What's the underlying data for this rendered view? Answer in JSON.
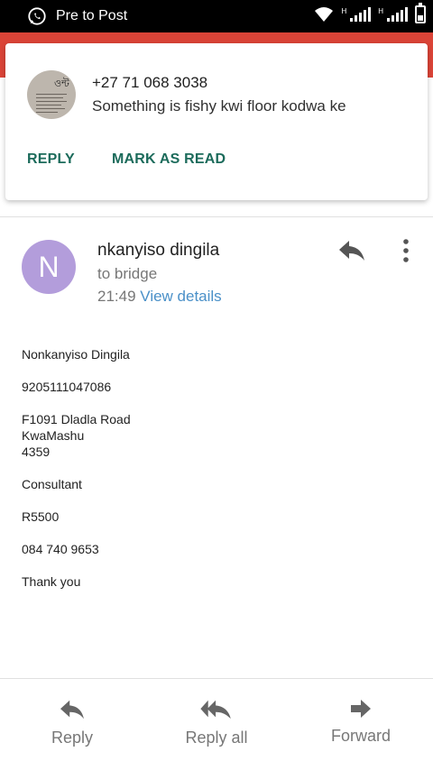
{
  "status_bar": {
    "app_title": "Pre to Post",
    "network_label_1": "H",
    "network_label_2": "H"
  },
  "notification": {
    "sender": "+27 71 068 3038",
    "message": "Something is fishy kwi floor kodwa ke",
    "reply_label": "REPLY",
    "mark_read_label": "MARK AS READ",
    "avatar_glyph": "ওন্ট"
  },
  "email": {
    "avatar_letter": "N",
    "avatar_color": "#b39ddb",
    "from_name": "nkanyiso dingila",
    "to_line": "to bridge",
    "time": "21:49",
    "view_details": "View details",
    "body": {
      "name": "Nonkanyiso Dingila",
      "id_number": "9205111047086",
      "address_line1": "F1091 Dladla Road",
      "address_line2": "KwaMashu",
      "address_line3": "4359",
      "occupation": "Consultant",
      "amount": "R5500",
      "phone": "084 740 9653",
      "closing": "Thank you"
    }
  },
  "actions": {
    "reply": "Reply",
    "reply_all": "Reply all",
    "forward": "Forward"
  },
  "colors": {
    "app_bar_red": "#db4437",
    "notification_action_teal": "#1c6b5b",
    "link_blue": "#4a90c8"
  }
}
